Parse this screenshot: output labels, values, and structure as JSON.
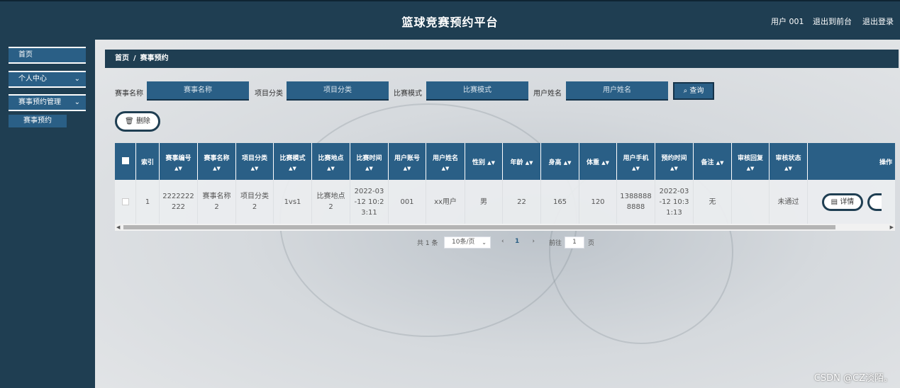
{
  "header": {
    "title": "篮球竞赛预约平台",
    "user": "用户 001",
    "back_front": "退出到前台",
    "logout": "退出登录"
  },
  "sidebar": {
    "items": [
      {
        "label": "首页"
      },
      {
        "label": "个人中心"
      },
      {
        "label": "赛事预约管理"
      }
    ],
    "sub_item": "赛事预约"
  },
  "breadcrumb": {
    "home": "首页",
    "sep": "/",
    "current": "赛事预约"
  },
  "search": {
    "fields": [
      {
        "label": "赛事名称",
        "placeholder": "赛事名称"
      },
      {
        "label": "项目分类",
        "placeholder": "项目分类"
      },
      {
        "label": "比赛模式",
        "placeholder": "比赛模式"
      },
      {
        "label": "用户姓名",
        "placeholder": "用户姓名"
      }
    ],
    "query_label": "查询"
  },
  "delete_label": "删除",
  "table": {
    "columns": [
      "索引",
      "赛事编号",
      "赛事名称",
      "项目分类",
      "比赛模式",
      "比赛地点",
      "比赛时间",
      "用户账号",
      "用户姓名",
      "性别",
      "年龄",
      "身高",
      "体重",
      "用户手机",
      "预约时间",
      "备注",
      "审核回复",
      "审核状态",
      "操作"
    ],
    "row": {
      "index": "1",
      "event_no": "2222222222",
      "event_name": "赛事名称2",
      "category": "项目分类2",
      "mode": "1vs1",
      "location": "比赛地点2",
      "match_time": "2022-03-12 10:23:11",
      "account": "001",
      "name": "xx用户",
      "gender": "男",
      "age": "22",
      "height": "165",
      "weight": "120",
      "phone": "13888888888",
      "booking_time": "2022-03-12 10:31:13",
      "remark": "无",
      "reply": "",
      "status": "未通过",
      "detail_label": "详情"
    }
  },
  "pagination": {
    "total": "共 1 条",
    "page_size": "10条/页",
    "current_page": "1",
    "goto": "前往",
    "goto_value": "1",
    "page_unit": "页"
  },
  "watermark": "CSDN @CZ淡陌。"
}
